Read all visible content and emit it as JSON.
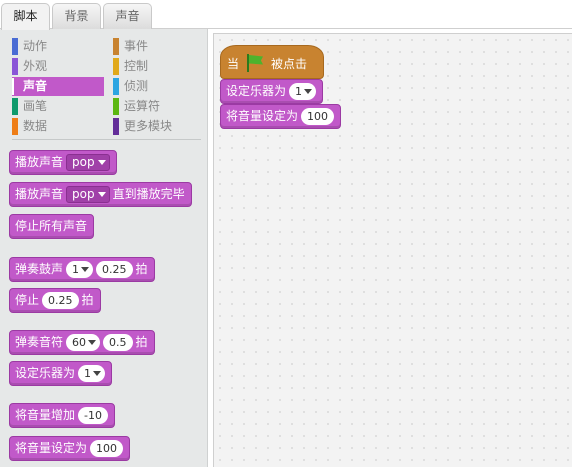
{
  "tabs": [
    {
      "label": "脚本",
      "active": true
    },
    {
      "label": "背景",
      "active": false
    },
    {
      "label": "声音",
      "active": false
    }
  ],
  "categories": [
    {
      "label": "动作",
      "color": "#4a6cd4",
      "active": false
    },
    {
      "label": "外观",
      "color": "#8a55d7",
      "active": false
    },
    {
      "label": "声音",
      "color": "#c159c9",
      "active": true
    },
    {
      "label": "画笔",
      "color": "#0e9a6c",
      "active": false
    },
    {
      "label": "数据",
      "color": "#ee7d16",
      "active": false
    },
    {
      "label": "事件",
      "color": "#c88330",
      "active": false
    },
    {
      "label": "控制",
      "color": "#e1a91a",
      "active": false
    },
    {
      "label": "侦测",
      "color": "#2ca5e2",
      "active": false
    },
    {
      "label": "运算符",
      "color": "#5cb712",
      "active": false
    },
    {
      "label": "更多模块",
      "color": "#632d99",
      "active": false
    }
  ],
  "palette_blocks": {
    "play_sound": {
      "label": "播放声音",
      "sound": "pop"
    },
    "play_sound_until_done": {
      "label": "播放声音",
      "sound": "pop",
      "suffix": "直到播放完毕"
    },
    "stop_all_sounds": {
      "label": "停止所有声音"
    },
    "play_drum": {
      "label": "弹奏鼓声",
      "drum": "1",
      "beats": "0.25",
      "suffix": "拍"
    },
    "rest": {
      "label": "停止",
      "beats": "0.25",
      "suffix": "拍"
    },
    "play_note": {
      "label": "弹奏音符",
      "note": "60",
      "beats": "0.5",
      "suffix": "拍"
    },
    "set_instrument": {
      "label": "设定乐器为",
      "instrument": "1"
    },
    "change_volume": {
      "label": "将音量增加",
      "value": "-10"
    },
    "set_volume": {
      "label": "将音量设定为",
      "value": "100"
    }
  },
  "script": {
    "hat_prefix": "当",
    "hat_suffix": "被点击",
    "set_instrument": {
      "label": "设定乐器为",
      "instrument": "1"
    },
    "set_volume": {
      "label": "将音量设定为",
      "value": "100"
    }
  }
}
